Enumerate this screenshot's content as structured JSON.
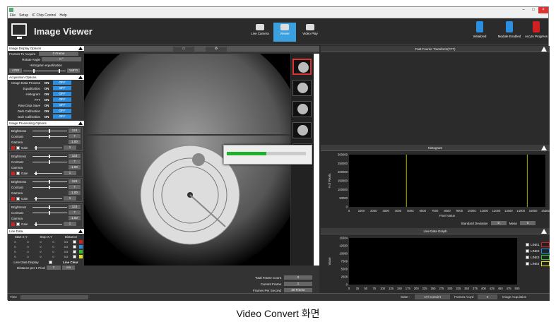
{
  "window": {
    "minimize": "–",
    "maximize": "□",
    "close": "×"
  },
  "menu": [
    "File",
    "Setup",
    "IC Chip Control",
    "Help"
  ],
  "app_title": "Image Viewer",
  "top_buttons": [
    {
      "label": "Live Camera",
      "active": false
    },
    {
      "label": "Viewer",
      "active": true
    },
    {
      "label": "Video Play",
      "active": false
    }
  ],
  "status_indicators": [
    {
      "label": "Initialized",
      "color": "#2a8fe0"
    },
    {
      "label": "Module Enabled",
      "color": "#2a8fe0"
    },
    {
      "label": "Acq In Progress",
      "color": "#d02020"
    }
  ],
  "display_options": {
    "title": "Image Display Options",
    "frames_to_acquire_label": "Frames To Acquire",
    "frames_to_acquire": "0 Frame",
    "rotate_label": "Rotate Angle",
    "rotate": "0 °",
    "hist_eq_label": "Histogram equalization",
    "hist_min": "4789",
    "hist_max": "14871"
  },
  "acq_options": {
    "title": "Acquisition Options",
    "rows": [
      {
        "label": "Image Data Process",
        "on": "ON",
        "off": "OFF"
      },
      {
        "label": "Equalization",
        "on": "ON",
        "off": "OFF"
      },
      {
        "label": "Histogram",
        "on": "ON",
        "off": "OFF"
      },
      {
        "label": "FFT",
        "on": "ON",
        "off": "OFF"
      },
      {
        "label": "Raw Data Save",
        "on": "ON",
        "off": "OFF"
      },
      {
        "label": "Dark Calibration",
        "on": "ON",
        "off": "OFF"
      },
      {
        "label": "Gain Calibration",
        "on": "ON",
        "off": "OFF"
      }
    ]
  },
  "proc_options": {
    "title": "Image Processing Options",
    "sets": [
      {
        "brightness_label": "Brightness",
        "brightness": "124",
        "contrast_label": "Contrast",
        "contrast": "7",
        "gamma_label": "Gamma",
        "gamma": "1.00",
        "gain_label": "Gain",
        "gain": "1",
        "slider": 0.45
      },
      {
        "brightness_label": "Brightness",
        "brightness": "124",
        "contrast_label": "Contrast",
        "contrast": "7",
        "gamma_label": "Gamma",
        "gamma": "1.00",
        "gain_label": "Gain",
        "gain": "1",
        "slider": 0.45
      },
      {
        "brightness_label": "Brightness",
        "brightness": "124",
        "contrast_label": "Contrast",
        "contrast": "7",
        "gamma_label": "Gamma",
        "gamma": "1.00",
        "gain_label": "Gain",
        "gain": "1",
        "slider": 0.45
      },
      {
        "brightness_label": "Brightness",
        "brightness": "124",
        "contrast_label": "Contrast",
        "contrast": "7",
        "gamma_label": "Gamma",
        "gamma": "1.00",
        "gain_label": "Gain",
        "gain": "1",
        "slider": 0.45
      }
    ]
  },
  "line_data": {
    "title": "Line Data",
    "start_label": "Start X,Y",
    "stop_label": "Stop X,Y",
    "distance_label": "Distance",
    "rows": [
      {
        "cells": [
          "0",
          "0",
          "0",
          "0",
          "0.0"
        ],
        "color": "#d02020"
      },
      {
        "cells": [
          "0",
          "0",
          "0",
          "0",
          "0.0"
        ],
        "color": "#2a8fe0"
      },
      {
        "cells": [
          "0",
          "0",
          "0",
          "0",
          "0.0"
        ],
        "color": "#30c030"
      },
      {
        "cells": [
          "0",
          "0",
          "0",
          "0",
          "0.0"
        ],
        "color": "#e0e020"
      }
    ],
    "display_label": "Line Data Display",
    "clear_label": "Line Clear",
    "dist_pixel_label": "Distance per 1 Pixel",
    "dist_pixel": "1",
    "unit": "cm"
  },
  "viewer": {
    "folder_icon": "folder-icon",
    "recycle_icon": "recycle-icon",
    "total_frame_label": "Total Frame Count",
    "total_frame": "0",
    "current_frame_label": "Current Frame",
    "current_frame": "1",
    "fps_label": "Frames Per Second",
    "fps": "30 Frame",
    "progress": 0.5
  },
  "fft": {
    "title": "Fast Fourier Transform(FFT)"
  },
  "histogram": {
    "title": "Histogram",
    "std_label": "Standard Deviation",
    "std": "0",
    "mean_label": "Mean",
    "mean": "0"
  },
  "line_graph": {
    "title": "Line Data Graph",
    "legend": [
      {
        "name": "LINE1",
        "color": "#d02020"
      },
      {
        "name": "LINE2",
        "color": "#2a8fe0"
      },
      {
        "name": "LINE3",
        "color": "#30c030"
      },
      {
        "name": "LINE4",
        "color": "#e0e020"
      }
    ]
  },
  "status": {
    "time_label": "Time",
    "state_label": "State :",
    "state": "AVI Convert",
    "frames_acq_label": "Frames Acq'd",
    "frames_acq": "0",
    "acq_label": "Image Acquistion"
  },
  "caption": "Video Convert 화면",
  "chart_data": [
    {
      "type": "bar",
      "title": "Histogram",
      "xlabel": "Pixel Value",
      "ylabel": "# of Pixels",
      "xlim": [
        0,
        16383
      ],
      "ylim": [
        0,
        300000
      ],
      "x_ticks": [
        "0",
        "1000",
        "2000",
        "3000",
        "4000",
        "5000",
        "6000",
        "7000",
        "8000",
        "9000",
        "10000",
        "11000",
        "12000",
        "13000",
        "14000",
        "15000",
        "16383"
      ],
      "y_ticks": [
        "0",
        "50000",
        "100000",
        "150000",
        "200000",
        "250000",
        "300000"
      ],
      "markers": [
        4789,
        14871
      ],
      "grid": false
    },
    {
      "type": "line",
      "title": "Line Data Graph",
      "xlabel": "",
      "ylabel": "Value",
      "xlim": [
        0,
        500
      ],
      "ylim": [
        0,
        16384
      ],
      "x_ticks": [
        "0",
        "25",
        "50",
        "75",
        "100",
        "125",
        "150",
        "175",
        "200",
        "225",
        "250",
        "275",
        "300",
        "325",
        "350",
        "375",
        "400",
        "425",
        "450",
        "475",
        "500"
      ],
      "y_ticks": [
        "0",
        "2508",
        "5509",
        "7509",
        "10080",
        "12580",
        "16384"
      ],
      "series": [
        {
          "name": "LINE1",
          "values": []
        },
        {
          "name": "LINE2",
          "values": []
        },
        {
          "name": "LINE3",
          "values": []
        },
        {
          "name": "LINE4",
          "values": []
        }
      ],
      "legend": "right",
      "grid": false
    }
  ]
}
